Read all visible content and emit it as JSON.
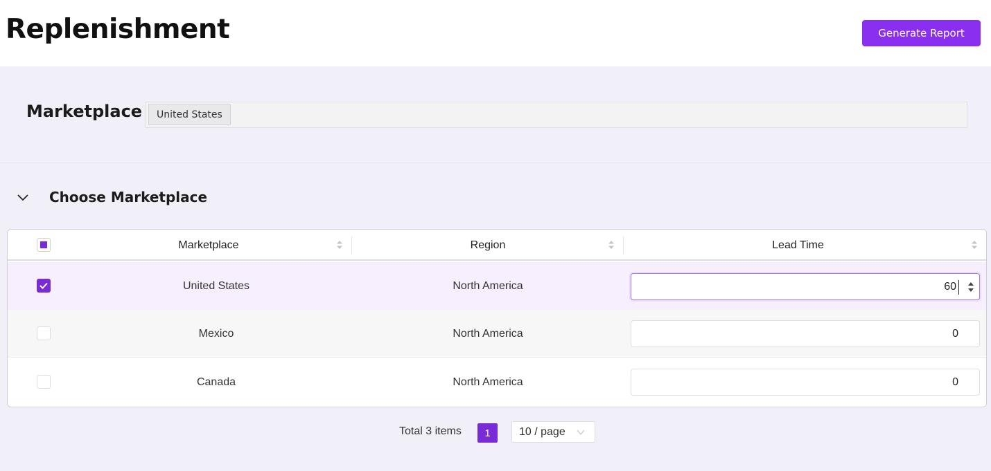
{
  "header": {
    "title": "Replenishment",
    "generate_button": "Generate Report"
  },
  "marketplace_filter": {
    "label": "Marketplace",
    "selected_tag": "United States"
  },
  "section": {
    "title": "Choose Marketplace",
    "expanded": true
  },
  "table": {
    "columns": [
      "Marketplace",
      "Region",
      "Lead Time"
    ],
    "select_all_state": "indeterminate",
    "rows": [
      {
        "marketplace": "United States",
        "region": "North America",
        "lead_time": "60",
        "checked": true,
        "focused": true
      },
      {
        "marketplace": "Mexico",
        "region": "North America",
        "lead_time": "0",
        "checked": false,
        "focused": false
      },
      {
        "marketplace": "Canada",
        "region": "North America",
        "lead_time": "0",
        "checked": false,
        "focused": false
      }
    ]
  },
  "pagination": {
    "total_text": "Total 3 items",
    "current_page": "1",
    "page_size": "10 / page"
  },
  "colors": {
    "accent": "#8a2ff0",
    "accent_dark": "#7a2bd8",
    "content_bg": "#f1eff8",
    "selected_row_bg": "#f7eefe"
  }
}
